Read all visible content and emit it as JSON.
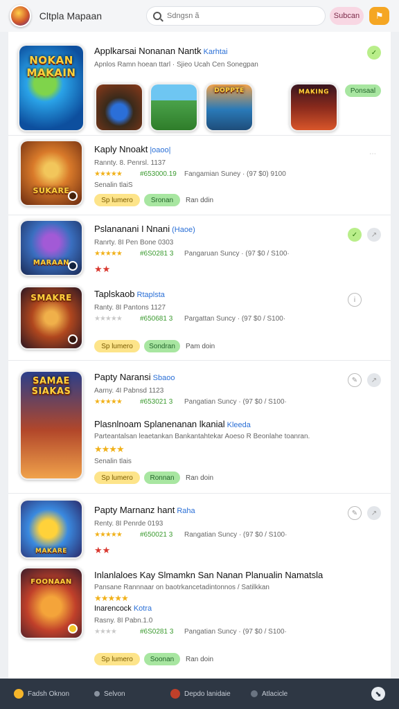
{
  "header": {
    "app_name": "Cltpla Mapaan",
    "search_placeholder": "Sdngsn ã",
    "search_button": "Subcan",
    "flag_button": "⚑"
  },
  "featured": {
    "main_art_text": "NOKAN MAKAIN",
    "title": "Applkarsai Nonanan Nantk",
    "title_tag": "Karhtai",
    "subtitle": "Apnlos Ramn hoean ttarl · Sjieo Ucah Cen Sonegpan",
    "mini_art_texts": [
      "",
      "",
      "DOPPTE",
      "MAKING"
    ],
    "badge": "Ponsaal"
  },
  "cards": [
    {
      "art_text": "SUKARE",
      "title": "Kaply Nnoakt",
      "tag": "|oaoo|",
      "line1": "Rannty. 8. Penrsl. 1137",
      "stars": "★★★★★",
      "rating_code": "#653000.19",
      "meta": "Fangamian  Suney · (97 $0) 9100",
      "line3": "Senalin tlaiS",
      "chip_yellow": "Sp lumero",
      "chip_green": "Sronan",
      "chip_text": "Ran ddin"
    },
    {
      "art_text": "MARAAN",
      "title": "Pslananani I Nnani",
      "tag": "(Haoe)",
      "line1": "Ranrty. 8I Pen Bone 0303",
      "stars": "★★★★★",
      "rating_code": "#6S0281 3",
      "meta": "Pangaruan  Suncy · (97 $0 / S100·",
      "red_stars": "★★"
    },
    {
      "art_text": "SMAKRE",
      "title": "Taplskaob",
      "tag": "Rtaplsta",
      "line1": "Ranty. 8I Pantons 1127",
      "stars": "★★★★★",
      "rating_code": "#650681 3",
      "meta": "Pargattan  Suncy · (97 $0 / S100·",
      "chip_yellow": "Sp lumero",
      "chip_green": "Sondran",
      "chip_text": "Pam doin"
    },
    {
      "art_text": "SAMAE SIAKAS",
      "title": "Papty Naransi",
      "tag": "Sbaoo",
      "line1": "Aarny. 4I Pabnsd 1123",
      "stars": "★★★★★",
      "rating_code": "#653021 3",
      "meta": "Pangatian  Suncy · (97 $0 / S100·",
      "title2": "Plasnlnoam Splanenanan lkanial",
      "title2_tag": "Kleeda",
      "desc": "Parteantalsan leaetankan Bankantahtekar Aoeso R Beonlahe toanran.",
      "stars2": "★★★★",
      "line3": "Senalin tlais",
      "chip_yellow": "Sp lumero",
      "chip_green": "Ronnan",
      "chip_text": "Ran doin"
    },
    {
      "art_text": "MAKARE",
      "title": "Papty Marnanz hant",
      "tag": "Raha",
      "line1": "Renty. 8I Penrde 0193",
      "stars": "★★★★★",
      "rating_code": "#650021 3",
      "meta": "Rangatian  Suncy · (97 $0 / S100·",
      "red_stars": "★★"
    },
    {
      "art_text": "FOONAAN",
      "title": "Inlanlaloes Kay Slmamkn San Nanan Planualin Namatsla",
      "tag": "",
      "line1": "Pansane  Rannnaar on baotrkancetadintonnos / Satilkkan",
      "stars_top": "★★★★★",
      "title_sub": "Inarencock",
      "title_sub_tag": "Kotra",
      "line2": "Rasny. 8I Pabn.1.0",
      "stars": "★★★★",
      "rating_code": "#6S0281 3",
      "meta": "Pangatian  Suncy · (97 $0 / S100·",
      "chip_yellow": "Sp lumero",
      "chip_green": "Soonan",
      "chip_text": "Ran doin"
    }
  ],
  "bottom_nav": {
    "items": [
      "Fadsh Oknon",
      "Selvon",
      "Depdo lanidaie",
      "Atlacicle"
    ],
    "fab": "⬊"
  },
  "colors": {
    "accent_yellow": "#fde48a",
    "accent_green": "#a8e6a1",
    "link_blue": "#2a6fd6",
    "bottom_bar": "#2e3744"
  }
}
